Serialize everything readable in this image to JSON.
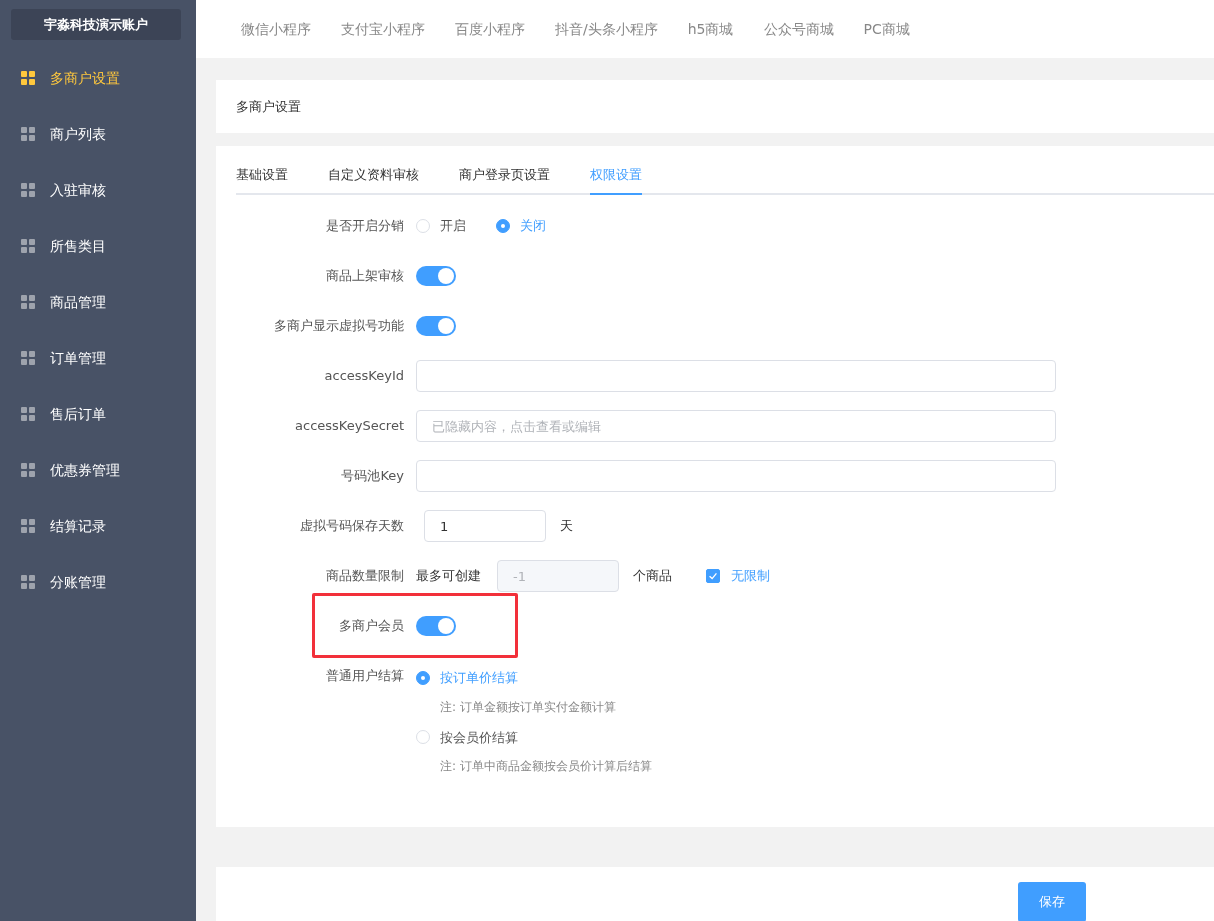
{
  "sidebar": {
    "account": "宇淼科技演示账户",
    "items": [
      {
        "label": "多商户设置",
        "selected": true
      },
      {
        "label": "商户列表",
        "selected": false
      },
      {
        "label": "入驻审核",
        "selected": false
      },
      {
        "label": "所售类目",
        "selected": false
      },
      {
        "label": "商品管理",
        "selected": false
      },
      {
        "label": "订单管理",
        "selected": false
      },
      {
        "label": "售后订单",
        "selected": false
      },
      {
        "label": "优惠券管理",
        "selected": false
      },
      {
        "label": "结算记录",
        "selected": false
      },
      {
        "label": "分账管理",
        "selected": false
      }
    ]
  },
  "top_tabs": [
    {
      "label": "微信小程序",
      "selected": false
    },
    {
      "label": "支付宝小程序",
      "selected": false
    },
    {
      "label": "百度小程序",
      "selected": false
    },
    {
      "label": "抖音/头条小程序",
      "selected": false
    },
    {
      "label": "h5商城",
      "selected": false
    },
    {
      "label": "公众号商城",
      "selected": false
    },
    {
      "label": "PC商城",
      "selected": false
    }
  ],
  "page_title": "多商户设置",
  "settings_tabs": [
    {
      "label": "基础设置",
      "selected": false
    },
    {
      "label": "自定义资料审核",
      "selected": false
    },
    {
      "label": "商户登录页设置",
      "selected": false
    },
    {
      "label": "权限设置",
      "selected": true
    }
  ],
  "form": [
    {
      "kind": "radio",
      "label": "是否开启分销",
      "highlighted": false,
      "options": [
        {
          "label": "开启",
          "selected": false
        },
        {
          "label": "关闭",
          "selected": true
        }
      ]
    },
    {
      "kind": "switch",
      "label": "商品上架审核",
      "highlighted": false,
      "on": true
    },
    {
      "kind": "switch",
      "label": "多商户显示虚拟号功能",
      "highlighted": false,
      "on": true
    },
    {
      "kind": "input",
      "label": "accessKeyId",
      "highlighted": false
    },
    {
      "kind": "input",
      "label": "accessKeySecret",
      "highlighted": false,
      "placeholder": "已隐藏内容，点击查看或编辑"
    },
    {
      "kind": "input",
      "label": "号码池Key",
      "highlighted": false
    },
    {
      "kind": "number",
      "label": "虚拟号码保存天数",
      "highlighted": false,
      "value": "1",
      "unit": "天"
    },
    {
      "kind": "limit",
      "label": "商品数量限制",
      "highlighted": false,
      "prefix": "最多可创建",
      "value": "-1",
      "disabled": true,
      "suffix": "个商品",
      "checkbox": {
        "label": "无限制",
        "checked": true
      }
    },
    {
      "kind": "switch",
      "label": "多商户会员",
      "highlighted": true,
      "on": true
    },
    {
      "kind": "radio_stack",
      "label": "普通用户结算",
      "highlighted": false,
      "options": [
        {
          "label": "按订单价结算",
          "selected": true,
          "note": "注: 订单金额按订单实付金额计算"
        },
        {
          "label": "按会员价结算",
          "selected": false,
          "note": "注: 订单中商品金额按会员价计算后结算"
        }
      ]
    }
  ],
  "save_button": "保存"
}
